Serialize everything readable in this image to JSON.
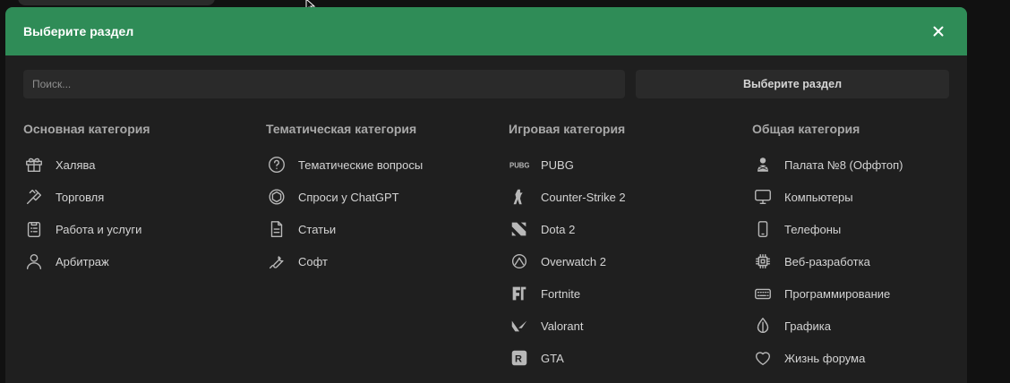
{
  "modal": {
    "title": "Выберите раздел"
  },
  "toolbar": {
    "search_placeholder": "Поиск...",
    "section_button_label": "Выберите раздел"
  },
  "colors": {
    "header": "#2f8c57",
    "panel": "#1f1f1f",
    "field": "#2a2a2a"
  },
  "columns": [
    {
      "title": "Основная категория",
      "items": [
        {
          "label": "Халява",
          "icon": "gift-icon"
        },
        {
          "label": "Торговля",
          "icon": "handshake-icon"
        },
        {
          "label": "Работа и услуги",
          "icon": "clipboard-icon"
        },
        {
          "label": "Арбитраж",
          "icon": "user-icon"
        }
      ]
    },
    {
      "title": "Тематическая категория",
      "items": [
        {
          "label": "Тематические вопросы",
          "icon": "question-icon"
        },
        {
          "label": "Спроси у ChatGPT",
          "icon": "openai-icon"
        },
        {
          "label": "Статьи",
          "icon": "document-icon"
        },
        {
          "label": "Софт",
          "icon": "wrench-icon"
        }
      ]
    },
    {
      "title": "Игровая категория",
      "items": [
        {
          "label": "PUBG",
          "icon": "pubg-icon"
        },
        {
          "label": "Counter-Strike 2",
          "icon": "counter-strike-icon"
        },
        {
          "label": "Dota 2",
          "icon": "dota-icon"
        },
        {
          "label": "Overwatch 2",
          "icon": "overwatch-icon"
        },
        {
          "label": "Fortnite",
          "icon": "fortnite-icon"
        },
        {
          "label": "Valorant",
          "icon": "valorant-icon"
        },
        {
          "label": "GTA",
          "icon": "gta-icon"
        }
      ]
    },
    {
      "title": "Общая категория",
      "items": [
        {
          "label": "Палата №8 (Оффтоп)",
          "icon": "patient-icon"
        },
        {
          "label": "Компьютеры",
          "icon": "monitor-icon"
        },
        {
          "label": "Телефоны",
          "icon": "phone-icon"
        },
        {
          "label": "Веб-разработка",
          "icon": "chip-icon"
        },
        {
          "label": "Программирование",
          "icon": "keyboard-icon"
        },
        {
          "label": "Графика",
          "icon": "drop-icon"
        },
        {
          "label": "Жизнь форума",
          "icon": "heart-icon"
        }
      ]
    }
  ]
}
